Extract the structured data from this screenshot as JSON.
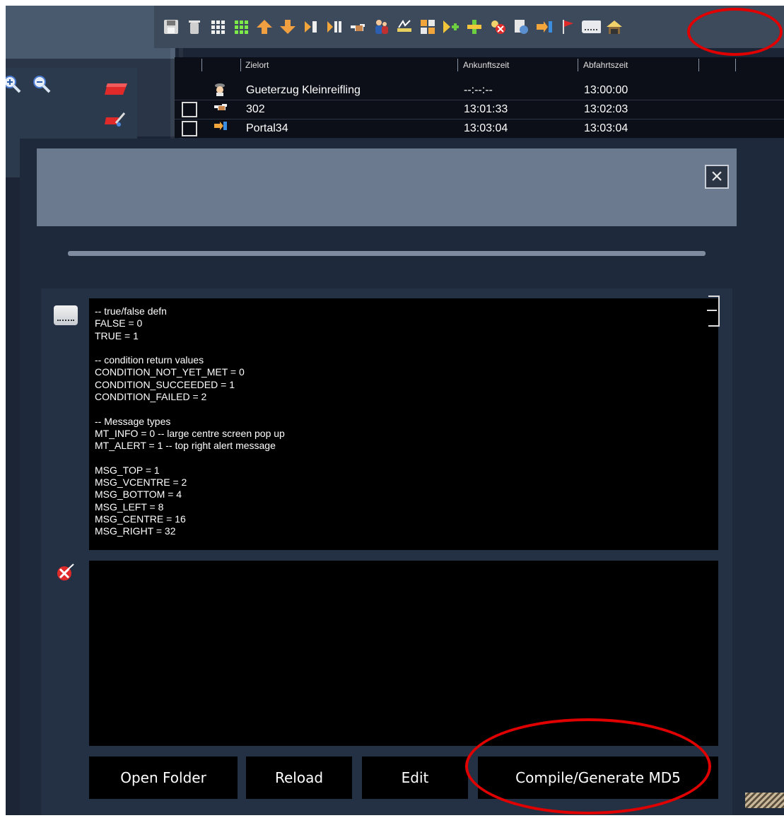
{
  "toolbar": {
    "icons": [
      "save-icon",
      "trash-icon",
      "grid-white-icon",
      "grid-green-icon",
      "arrow-up-icon",
      "arrow-down-icon",
      "goto-icon",
      "split-icon",
      "hand-point-icon",
      "people-icon",
      "consist-icon",
      "layout-icon",
      "add-yellow-icon",
      "add-plus-icon",
      "no-entry-icon",
      "settings-icon",
      "portal-icon",
      "flag-icon",
      "script-icon",
      "depot-icon"
    ]
  },
  "timetable": {
    "headers": {
      "destination": "Zielort",
      "arrival": "Ankunftszeit",
      "departure": "Abfahrtszeit"
    },
    "rows": [
      {
        "destination": "Gueterzug Kleinreifling",
        "arrival": "--:--:--",
        "departure": "13:00:00",
        "icon": "train-driver-icon"
      },
      {
        "destination": "302",
        "arrival": "13:01:33",
        "departure": "13:02:03",
        "icon": "hand-point-icon"
      },
      {
        "destination": "Portal34",
        "arrival": "13:03:04",
        "departure": "13:03:04",
        "icon": "portal-icon"
      }
    ]
  },
  "script": {
    "lines": [
      "-- true/false defn",
      "FALSE = 0",
      "TRUE = 1",
      "",
      "-- condition return values",
      "CONDITION_NOT_YET_MET = 0",
      "CONDITION_SUCCEEDED = 1",
      "CONDITION_FAILED = 2",
      "",
      "-- Message types",
      "MT_INFO = 0 -- large centre screen pop up",
      "MT_ALERT = 1 -- top right alert message",
      "",
      "MSG_TOP = 1",
      "MSG_VCENTRE = 2",
      "MSG_BOTTOM = 4",
      "MSG_LEFT = 8",
      "MSG_CENTRE = 16",
      "MSG_RIGHT = 32"
    ]
  },
  "buttons": {
    "open_folder": "Open Folder",
    "reload": "Reload",
    "edit": "Edit",
    "compile": "Compile/Generate MD5"
  },
  "colors": {
    "highlight": "#e00000",
    "background": "#1b2535",
    "code_bg": "#000000"
  }
}
